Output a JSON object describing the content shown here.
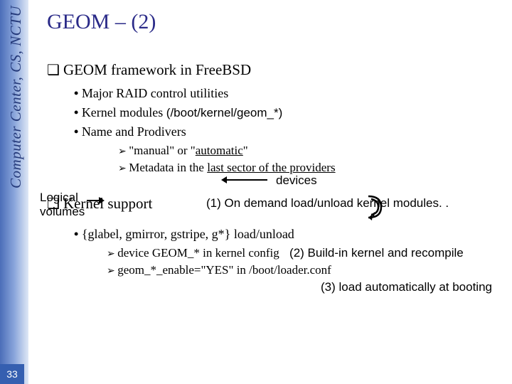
{
  "sidebar": {
    "label": "Computer Center, CS, NCTU"
  },
  "page_number": "33",
  "title": "GEOM – (2)",
  "section1": {
    "heading": "GEOM framework in FreeBSD",
    "bullets": {
      "b1": "Major RAID control utilities",
      "b2_a": "Kernel modules ",
      "b2_b": "(/boot/kernel/geom_*)",
      "b3": "Name and Prodivers"
    },
    "subs": {
      "s1_a": "\"manual\" or \"",
      "s1_b": "automatic",
      "s1_c": "\"",
      "s2_a": "Metadata in the ",
      "s2_b": "last sector of the providers"
    },
    "label_logical": "Logical volumes",
    "label_devices": "devices"
  },
  "section2": {
    "heading": "Kernel support",
    "annot1": "(1) On demand load/unload kernel modules. .",
    "bullets": {
      "b1": "{glabel, gmirror, gstripe, g*} load/unload"
    },
    "subs": {
      "s1": "device GEOM_* in kernel config",
      "s2": "geom_*_enable=\"YES\" in /boot/loader.conf"
    },
    "annot2": "(2) Build-in kernel and recompile",
    "annot3": "(3) load automatically at booting"
  }
}
